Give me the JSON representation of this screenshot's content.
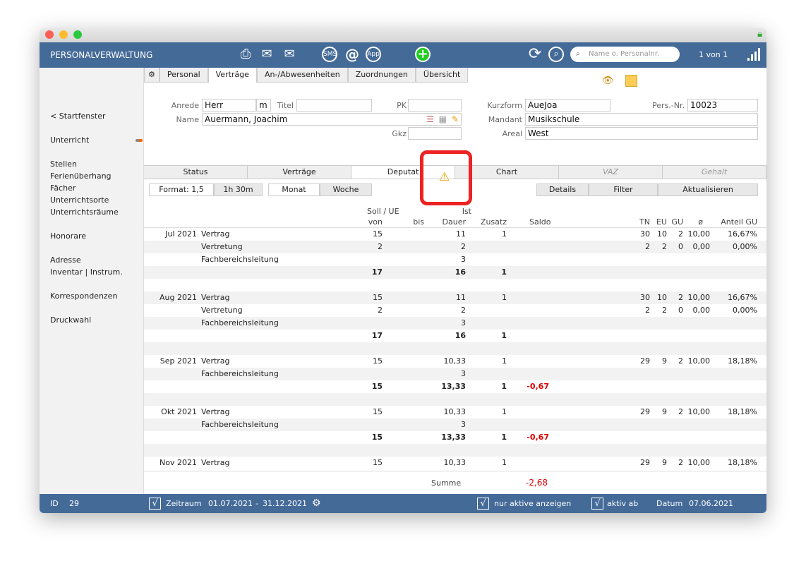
{
  "app": {
    "title": "PERSONALVERWALTUNG",
    "search_placeholder": "Name o. Personalnr.",
    "record_count": "1 von 1"
  },
  "tabs": [
    "Personal",
    "Verträge",
    "An-/Abwesenheiten",
    "Zuordnungen",
    "Übersicht"
  ],
  "active_tab": "Verträge",
  "sidebar": [
    "< Startfenster",
    "Unterricht",
    "Stellen",
    "Ferienüberhang",
    "Fächer",
    "Unterrichtsorte",
    "Unterrichtsräume",
    "Honorare",
    "Adresse",
    "Inventar | Instrum.",
    "Korrespondenzen",
    "Druckwahl"
  ],
  "form": {
    "anrede_label": "Anrede",
    "anrede": "Herr",
    "geschlecht": "m",
    "titel_label": "Titel",
    "titel": "",
    "pk_label": "PK",
    "pk": "",
    "name_label": "Name",
    "name": "Auermann, Joachim",
    "gkz_label": "Gkz",
    "gkz": "",
    "kurzform_label": "Kurzform",
    "kurzform": "AueJoa",
    "persnr_label": "Pers.-Nr.",
    "persnr": "10023",
    "mandant_label": "Mandant",
    "mandant": "Musikschule",
    "areal_label": "Areal",
    "areal": "West"
  },
  "subtabs": [
    {
      "label": "Status"
    },
    {
      "label": "Verträge"
    },
    {
      "label": "Deputat",
      "active": true
    },
    {
      "label": "Chart"
    },
    {
      "label": "VAZ",
      "disabled": true
    },
    {
      "label": "Gehalt",
      "disabled": true
    }
  ],
  "buttons": {
    "format": "Format: 1,5",
    "time": "1h 30m",
    "monat": "Monat",
    "woche": "Woche",
    "details": "Details",
    "filter": "Filter",
    "refresh": "Aktualisieren"
  },
  "headers": {
    "soll": "Soll / UE",
    "ist": "Ist",
    "von": "von",
    "bis": "bis",
    "dauer": "Dauer",
    "zusatz": "Zusatz",
    "saldo": "Saldo",
    "tn": "TN",
    "eu": "EU",
    "gu": "GU",
    "avg": "ø",
    "anteil": "Anteil GU"
  },
  "rows": [
    {
      "month": "Jul 2021",
      "label": "Vertrag",
      "von": "15",
      "dauer": "11",
      "zusatz": "1",
      "tn": "30",
      "eu": "10",
      "gu": "2",
      "avg": "10,00",
      "anteil": "16,67%"
    },
    {
      "label": "Vertretung",
      "von": "2",
      "dauer": "2",
      "tn": "2",
      "eu": "2",
      "gu": "0",
      "avg": "0,00",
      "anteil": "0,00%"
    },
    {
      "label": "Fachbereichsleitung",
      "dauer": "3"
    },
    {
      "total": true,
      "von": "17",
      "dauer": "16",
      "zusatz": "1"
    },
    {},
    {
      "month": "Aug 2021",
      "label": "Vertrag",
      "von": "15",
      "dauer": "11",
      "zusatz": "1",
      "tn": "30",
      "eu": "10",
      "gu": "2",
      "avg": "10,00",
      "anteil": "16,67%"
    },
    {
      "label": "Vertretung",
      "von": "2",
      "dauer": "2",
      "tn": "2",
      "eu": "2",
      "gu": "0",
      "avg": "0,00",
      "anteil": "0,00%"
    },
    {
      "label": "Fachbereichsleitung",
      "dauer": "3"
    },
    {
      "total": true,
      "von": "17",
      "dauer": "16",
      "zusatz": "1"
    },
    {},
    {
      "month": "Sep 2021",
      "label": "Vertrag",
      "von": "15",
      "dauer": "10,33",
      "zusatz": "1",
      "tn": "29",
      "eu": "9",
      "gu": "2",
      "avg": "10,00",
      "anteil": "18,18%"
    },
    {
      "label": "Fachbereichsleitung",
      "dauer": "3"
    },
    {
      "total": true,
      "von": "15",
      "dauer": "13,33",
      "zusatz": "1",
      "saldo": "-0,67"
    },
    {},
    {
      "month": "Okt 2021",
      "label": "Vertrag",
      "von": "15",
      "dauer": "10,33",
      "zusatz": "1",
      "tn": "29",
      "eu": "9",
      "gu": "2",
      "avg": "10,00",
      "anteil": "18,18%"
    },
    {
      "label": "Fachbereichsleitung",
      "dauer": "3"
    },
    {
      "total": true,
      "von": "15",
      "dauer": "13,33",
      "zusatz": "1",
      "saldo": "-0,67"
    },
    {},
    {
      "month": "Nov 2021",
      "label": "Vertrag",
      "von": "15",
      "dauer": "10,33",
      "zusatz": "1",
      "tn": "29",
      "eu": "9",
      "gu": "2",
      "avg": "10,00",
      "anteil": "18,18%"
    }
  ],
  "summe": {
    "label": "Summe",
    "value": "-2,68"
  },
  "footer": {
    "id_label": "ID",
    "id": "29",
    "zeitraum_label": "Zeitraum",
    "zeitraum_von": "01.07.2021",
    "zeitraum_sep": "-",
    "zeitraum_bis": "31.12.2021",
    "nur_aktive": "nur aktive anzeigen",
    "aktiv_ab": "aktiv ab",
    "datum_label": "Datum",
    "datum": "07.06.2021",
    "check": "√"
  },
  "colors": {
    "header": "#446a98",
    "negative": "#dd0000",
    "highlight": "#ee2222"
  }
}
